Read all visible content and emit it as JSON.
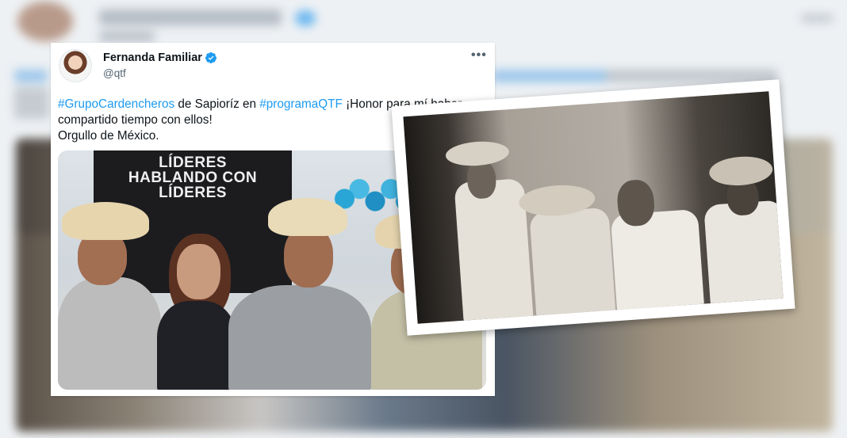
{
  "tweet": {
    "author_name": "Fernanda Familiar",
    "author_handle": "@qtf",
    "more_label": "•••",
    "text": {
      "hashtag1": "#GrupoCardencheros",
      "part1": " de Sapioríz en ",
      "hashtag2": "#programaQTF",
      "part2": " ¡Honor para mí haber compartido tiempo con ellos!",
      "line2": "Orgullo de México."
    },
    "photo": {
      "banner_line1": "LÍDERES",
      "banner_line2": "HABLANDO CON",
      "banner_line3": "LÍDERES"
    }
  },
  "colors": {
    "link": "#1d9bf0",
    "verified": "#1d9bf0",
    "text": "#0f1419",
    "muted": "#536471"
  },
  "icons": {
    "verified": "verified-badge-icon",
    "more": "more-options-icon"
  }
}
